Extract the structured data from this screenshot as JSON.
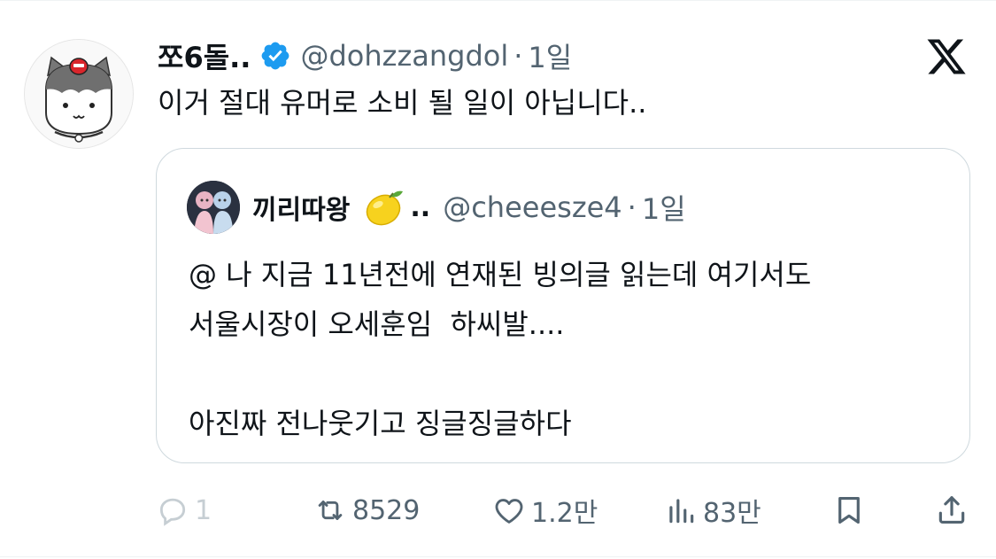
{
  "tweet": {
    "author": {
      "display_name": "쪼6돌..",
      "handle": "@dohzzangdol",
      "separator": "·",
      "time": "1일",
      "avatar_icon": "cat-mascot-avatar",
      "verified_icon": "verified-badge-icon",
      "verified_color": "#1d9bf0"
    },
    "text": "이거 절대 유머로 소비 될 일이 아닙니다..",
    "platform_icon": "x-logo-icon"
  },
  "quote": {
    "author": {
      "display_name": "끼리따왕",
      "emoji_icon": "lemon-icon",
      "name_suffix": "..",
      "handle": "@cheeesze4",
      "separator": "·",
      "time": "1일"
    },
    "text": "@ 나 지금 11년전에 연재된 빙의글 읽는데 여기서도\n서울시장이 오세훈임  하씨발....\n\n아진짜 전나웃기고 징글징글하다"
  },
  "actions": {
    "reply": {
      "icon": "reply-icon",
      "count": "1"
    },
    "retweet": {
      "icon": "retweet-icon",
      "count": "8529"
    },
    "like": {
      "icon": "heart-icon",
      "count": "1.2만"
    },
    "views": {
      "icon": "analytics-icon",
      "count": "83만"
    },
    "bookmark": {
      "icon": "bookmark-icon"
    },
    "share": {
      "icon": "share-icon"
    }
  },
  "colors": {
    "text_primary": "#0f1419",
    "text_secondary": "#536471",
    "border": "#cfd9de",
    "reply_dim": "#c6ced3"
  }
}
